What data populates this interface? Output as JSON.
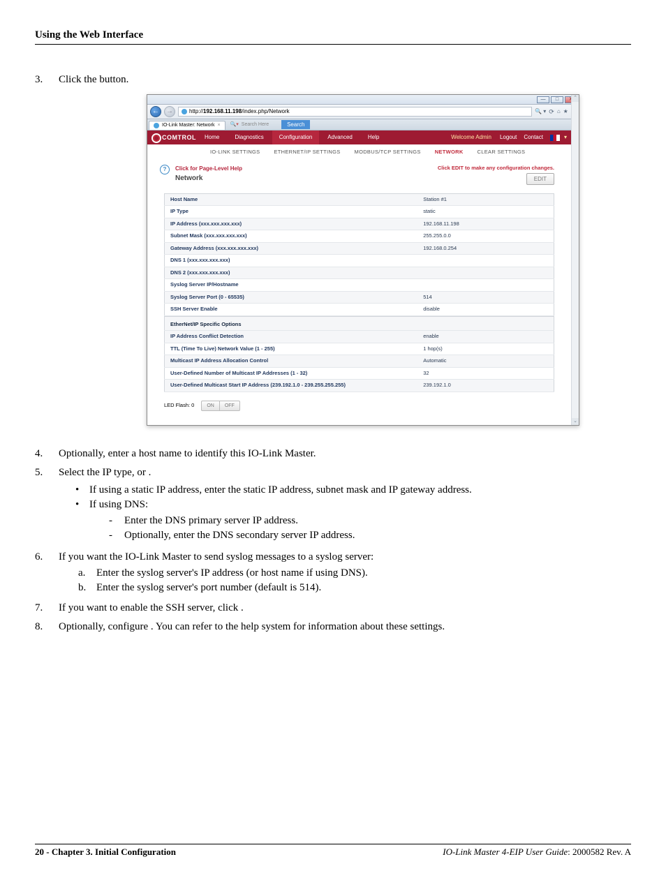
{
  "header": {
    "title": "Using the Web Interface"
  },
  "steps": {
    "s3": "Click the           button.",
    "s4": "Optionally, enter a host name to identify this IO-Link Master.",
    "s5": "Select the IP type,          or          .",
    "s5b1": "If using a static IP address, enter the static IP address, subnet mask and IP gateway address.",
    "s5b2": "If using DNS:",
    "s5b2d1": "Enter the DNS primary server IP address.",
    "s5b2d2": "Optionally, enter the DNS secondary server IP address.",
    "s6": "If you want the IO-Link Master to send syslog messages to a syslog server:",
    "s6a": "Enter the syslog server's IP address (or host name if using DNS).",
    "s6b": "Enter the syslog server's port number (default is 514).",
    "s7": "If you want to enable the SSH server, click            .",
    "s8": "Optionally, configure                                              . You can refer to the help system for information about these settings."
  },
  "browser": {
    "url_prefix": "http://",
    "url_host": "192.168.11.198",
    "url_path": "/index.php/Network",
    "tab_title": "IO-Link Master: Network",
    "search_placeholder": "Search Here",
    "search_btn": "Search",
    "refresh_sep": "⟳",
    "mag": "🔍 ▾"
  },
  "banner": {
    "brand": "COMTROL",
    "nav": [
      "Home",
      "Diagnostics",
      "Configuration",
      "Advanced",
      "Help"
    ],
    "welcome": "Welcome Admin",
    "right": [
      "Logout",
      "Contact"
    ]
  },
  "subnav": {
    "items": [
      "IO-LINK SETTINGS",
      "ETHERNET/IP SETTINGS",
      "MODBUS/TCP SETTINGS",
      "NETWORK",
      "CLEAR SETTINGS"
    ],
    "active_index": 3
  },
  "panel": {
    "help_link": "Click for Page-Level Help",
    "heading": "Network",
    "edit_note": "Click EDIT to make any configuration changes.",
    "edit_btn": "EDIT",
    "led_label": "LED Flash: 0",
    "on": "ON",
    "off": "OFF",
    "rows": [
      {
        "label": "Host Name",
        "value": "Station #1"
      },
      {
        "label": "IP Type",
        "value": "static"
      },
      {
        "label": "IP Address (xxx.xxx.xxx.xxx)",
        "value": "192.168.11.198"
      },
      {
        "label": "Subnet Mask (xxx.xxx.xxx.xxx)",
        "value": "255.255.0.0"
      },
      {
        "label": "Gateway Address (xxx.xxx.xxx.xxx)",
        "value": "192.168.0.254"
      },
      {
        "label": "DNS 1 (xxx.xxx.xxx.xxx)",
        "value": ""
      },
      {
        "label": "DNS 2 (xxx.xxx.xxx.xxx)",
        "value": ""
      },
      {
        "label": "Syslog Server IP/Hostname",
        "value": ""
      },
      {
        "label": "Syslog Server Port (0 - 65535)",
        "value": "514"
      },
      {
        "label": "SSH Server Enable",
        "value": "disable"
      }
    ],
    "section2": "EtherNet/IP Specific Options",
    "rows2": [
      {
        "label": "IP Address Conflict Detection",
        "value": "enable"
      },
      {
        "label": "TTL (Time To Live) Network Value (1 - 255)",
        "value": "1 hop(s)"
      },
      {
        "label": "Multicast IP Address Allocation Control",
        "value": "Automatic"
      },
      {
        "label": "User-Defined Number of Multicast IP Addresses (1 - 32)",
        "value": "32"
      },
      {
        "label": "User-Defined Multicast Start IP Address (239.192.1.0 - 239.255.255.255)",
        "value": "239.192.1.0"
      }
    ]
  },
  "footer": {
    "left_bold": "20 - Chapter 3. Initial Configuration",
    "right_italic": "IO-Link Master 4-EIP User Guide",
    "right_rest": ": 2000582 Rev. A"
  }
}
